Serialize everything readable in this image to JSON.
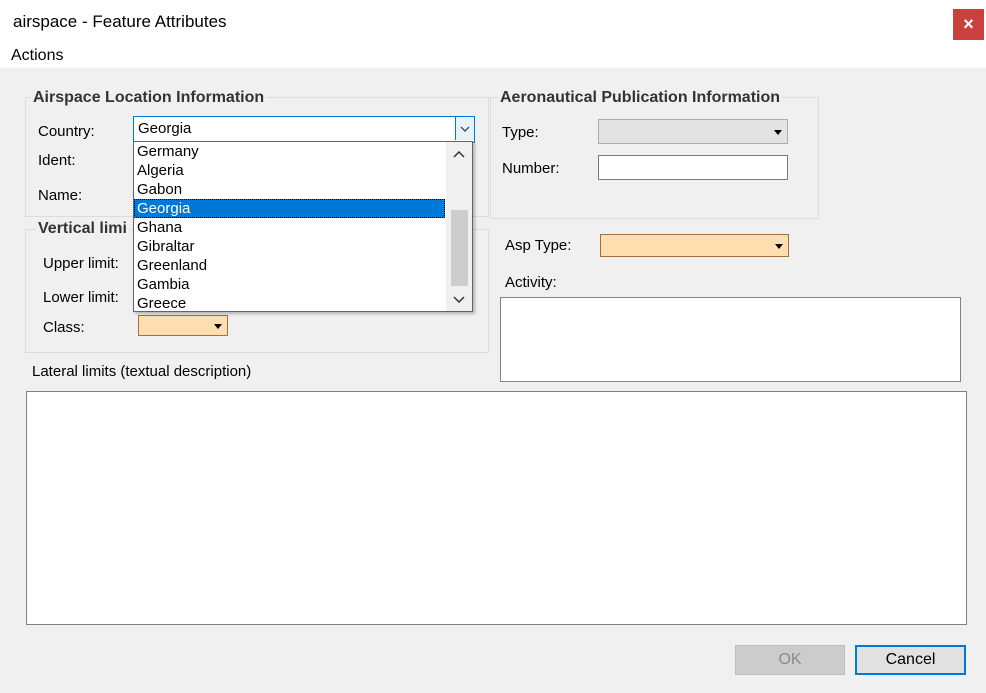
{
  "window": {
    "title": "airspace - Feature Attributes",
    "close_glyph": "×"
  },
  "menu": {
    "actions": "Actions"
  },
  "location": {
    "legend": "Airspace Location Information",
    "country_label": "Country:",
    "country_value": "Georgia",
    "ident_label": "Ident:",
    "name_label": "Name:",
    "dropdown_options": [
      "Germany",
      "Algeria",
      "Gabon",
      "Georgia",
      "Ghana",
      "Gibraltar",
      "Greenland",
      "Gambia",
      "Greece"
    ],
    "selected_option": "Georgia"
  },
  "vertical": {
    "legend": "Vertical limi",
    "upper_label": "Upper limit:",
    "lower_label": "Lower limit:",
    "class_label": "Class:"
  },
  "publication": {
    "legend": "Aeronautical Publication Information",
    "type_label": "Type:",
    "number_label": "Number:"
  },
  "asp": {
    "type_label": "Asp Type:",
    "activity_label": "Activity:"
  },
  "lateral": {
    "label": "Lateral limits (textual description)"
  },
  "buttons": {
    "ok": "OK",
    "cancel": "Cancel"
  },
  "colors": {
    "accent": "#0078d7",
    "peach": "#ffdfb0",
    "close_red": "#c9403e"
  }
}
